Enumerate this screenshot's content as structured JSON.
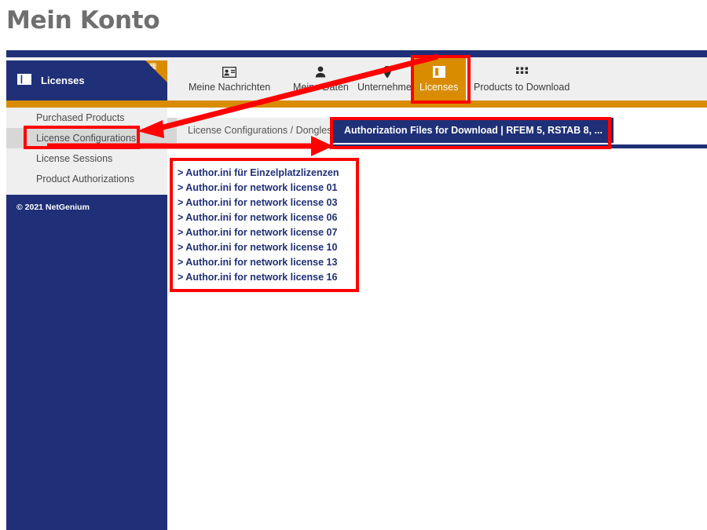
{
  "page": {
    "title": "Mein Konto"
  },
  "sidebar": {
    "header_label": "Licenses",
    "header_icon": "columns-icon",
    "corner_icon": "table-grid-icon",
    "items": [
      {
        "label": "Purchased Products",
        "active": false
      },
      {
        "label": "License Configurations",
        "active": true
      },
      {
        "label": "License Sessions",
        "active": false
      },
      {
        "label": "Product Authorizations",
        "active": false
      }
    ],
    "footer_text": "© 2021 NetGenium"
  },
  "nav": {
    "tabs": [
      {
        "label": "Meine Nachrichten",
        "icon": "id-card-icon",
        "active": false
      },
      {
        "label": "Meine Daten",
        "icon": "person-icon",
        "active": false
      },
      {
        "label": "Unternehmen",
        "icon": "location-pin-icon",
        "active": false
      },
      {
        "label": "Licenses",
        "icon": "license-card-icon",
        "active": true
      },
      {
        "label": "Products to Download",
        "icon": "grid-dots-icon",
        "active": false
      }
    ]
  },
  "subtabs": [
    {
      "label": "License Configurations / Dongles",
      "active": false
    },
    {
      "label": "Authorization Files for Download | RFEM 5, RSTAB 8, ...",
      "active": true
    }
  ],
  "downloads": {
    "links": [
      "> Author.ini für Einzelplatzlizenzen",
      "> Author.ini for network license 01",
      "> Author.ini for network license 03",
      "> Author.ini for network license 06",
      "> Author.ini for network license 07",
      "> Author.ini for network license 10",
      "> Author.ini for network license 13",
      "> Author.ini for network license 16"
    ]
  },
  "annotations": {
    "highlight_color": "#ff0000",
    "boxes": [
      "licenses-tab-highlight",
      "license-configurations-highlight",
      "authorization-files-tab-highlight",
      "download-links-highlight"
    ],
    "arrows": [
      "licenses-tab-to-license-configurations",
      "license-configurations-to-authorization-files"
    ]
  },
  "colors": {
    "brand_blue": "#1f3078",
    "brand_orange": "#d98c00",
    "tabbar_grey": "#efefef",
    "title_grey": "#6f6f6f"
  }
}
